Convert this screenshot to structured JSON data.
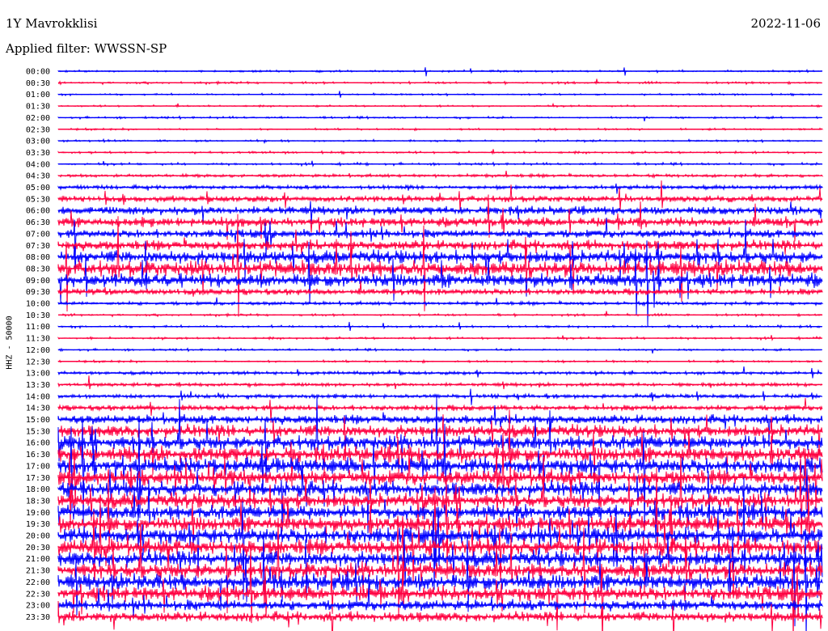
{
  "header": {
    "station": "1Y Mavrokklisi",
    "date": "2022-11-06",
    "filter": "Applied filter: WWSSN-SP",
    "channel": "HHZ - 50000"
  },
  "colors": {
    "trace_a": "#0000ff",
    "trace_b": "#ff0040",
    "background": "#ffffff",
    "text": "#000000"
  },
  "chart_data": {
    "type": "helicorder",
    "ylabel": "HHZ - 50000",
    "series": [
      {
        "label": "00:00",
        "activity": 0.05
      },
      {
        "label": "00:30",
        "activity": 0.08
      },
      {
        "label": "01:00",
        "activity": 0.04
      },
      {
        "label": "01:30",
        "activity": 0.03
      },
      {
        "label": "02:00",
        "activity": 0.06
      },
      {
        "label": "02:30",
        "activity": 0.05
      },
      {
        "label": "03:00",
        "activity": 0.05
      },
      {
        "label": "03:30",
        "activity": 0.07
      },
      {
        "label": "04:00",
        "activity": 0.08
      },
      {
        "label": "04:30",
        "activity": 0.1
      },
      {
        "label": "05:00",
        "activity": 0.15
      },
      {
        "label": "05:30",
        "activity": 0.3
      },
      {
        "label": "06:00",
        "activity": 0.45
      },
      {
        "label": "06:30",
        "activity": 0.5
      },
      {
        "label": "07:00",
        "activity": 0.45
      },
      {
        "label": "07:30",
        "activity": 0.55
      },
      {
        "label": "08:00",
        "activity": 0.75
      },
      {
        "label": "08:30",
        "activity": 0.95
      },
      {
        "label": "09:00",
        "activity": 0.8
      },
      {
        "label": "09:30",
        "activity": 0.3
      },
      {
        "label": "10:00",
        "activity": 0.12
      },
      {
        "label": "10:30",
        "activity": 0.08
      },
      {
        "label": "11:00",
        "activity": 0.08
      },
      {
        "label": "11:30",
        "activity": 0.07
      },
      {
        "label": "12:00",
        "activity": 0.06
      },
      {
        "label": "12:30",
        "activity": 0.07
      },
      {
        "label": "13:00",
        "activity": 0.1
      },
      {
        "label": "13:30",
        "activity": 0.12
      },
      {
        "label": "14:00",
        "activity": 0.15
      },
      {
        "label": "14:30",
        "activity": 0.25
      },
      {
        "label": "15:00",
        "activity": 0.5
      },
      {
        "label": "15:30",
        "activity": 0.7
      },
      {
        "label": "16:00",
        "activity": 0.85
      },
      {
        "label": "16:30",
        "activity": 0.9
      },
      {
        "label": "17:00",
        "activity": 0.95
      },
      {
        "label": "17:30",
        "activity": 0.9
      },
      {
        "label": "18:00",
        "activity": 0.85
      },
      {
        "label": "18:30",
        "activity": 0.85
      },
      {
        "label": "19:00",
        "activity": 0.85
      },
      {
        "label": "19:30",
        "activity": 0.9
      },
      {
        "label": "20:00",
        "activity": 0.95
      },
      {
        "label": "20:30",
        "activity": 0.95
      },
      {
        "label": "21:00",
        "activity": 0.9
      },
      {
        "label": "21:30",
        "activity": 0.95
      },
      {
        "label": "22:00",
        "activity": 0.95
      },
      {
        "label": "22:30",
        "activity": 0.85
      },
      {
        "label": "23:00",
        "activity": 0.6
      },
      {
        "label": "23:30",
        "activity": 0.55
      }
    ]
  }
}
